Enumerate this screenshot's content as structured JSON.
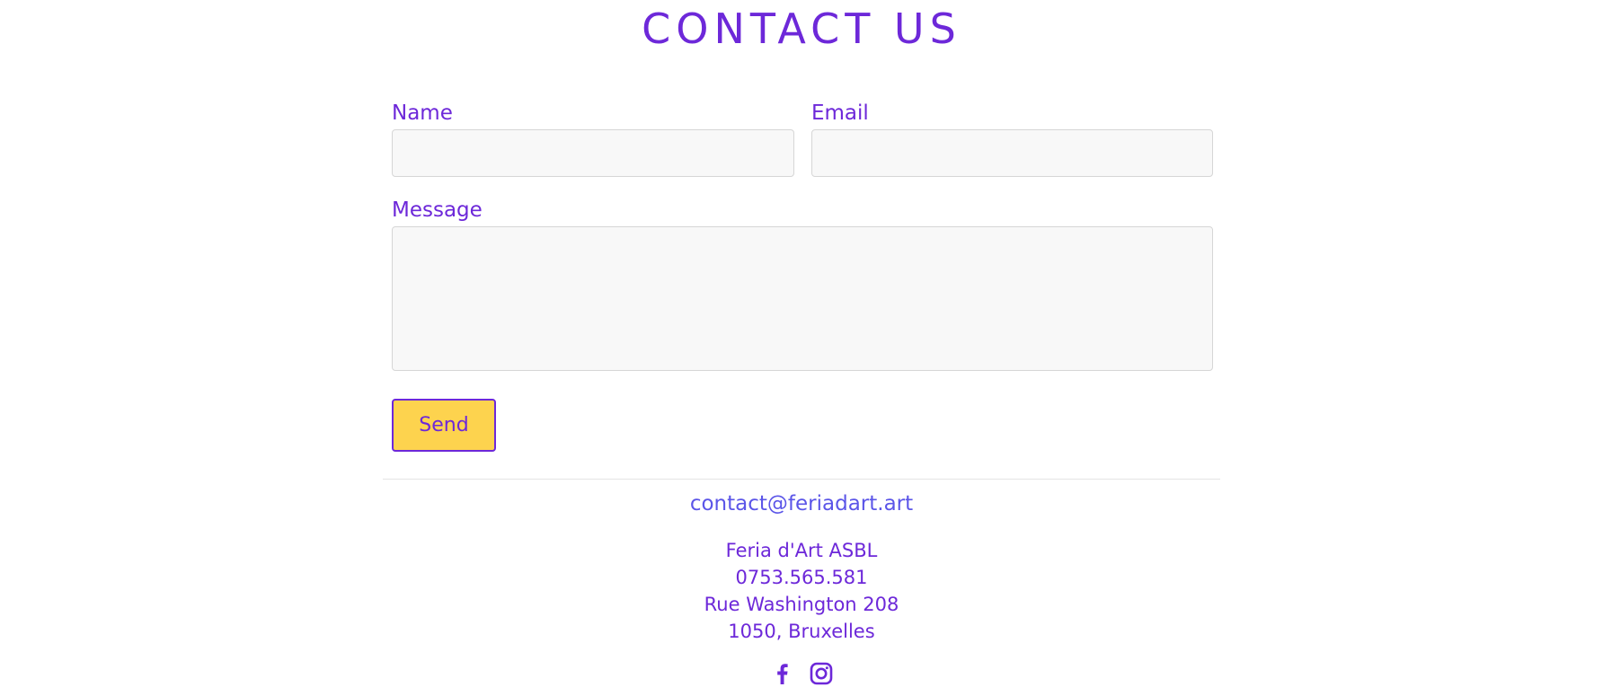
{
  "header": {
    "title": "CONTACT US"
  },
  "form": {
    "name_label": "Name",
    "name_value": "",
    "email_label": "Email",
    "email_value": "",
    "message_label": "Message",
    "message_value": "",
    "send_label": "Send"
  },
  "footer": {
    "email": "contact@feriadart.art",
    "address": {
      "org": "Feria d'Art ASBL",
      "phone": "0753.565.581",
      "street": "Rue Washington 208",
      "city": "1050, Bruxelles"
    },
    "social": {
      "facebook_icon": "facebook-icon",
      "instagram_icon": "instagram-icon"
    }
  },
  "colors": {
    "accent": "#6d28d9",
    "link": "#5b55e8",
    "button_bg": "#fdd34e",
    "field_bg": "#f8f8f8",
    "field_border": "#d6d6d6"
  }
}
